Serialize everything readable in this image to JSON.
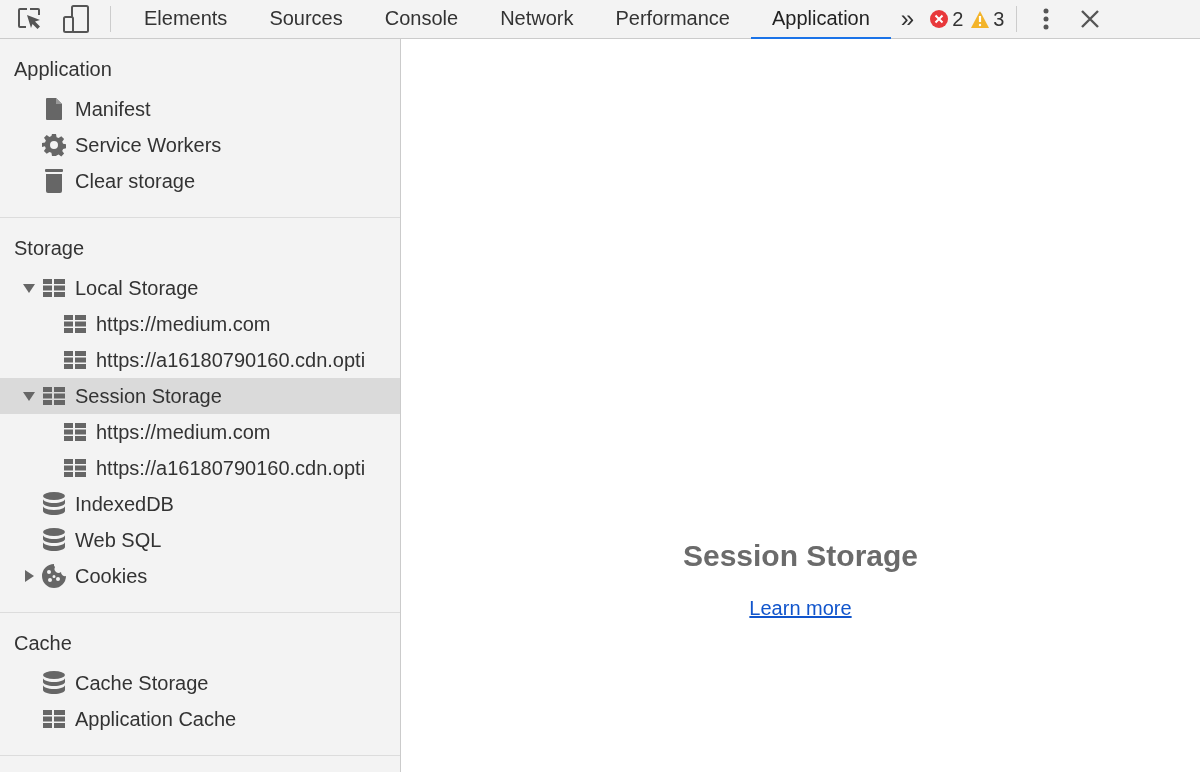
{
  "toolbar": {
    "tabs": [
      {
        "label": "Elements",
        "selected": false
      },
      {
        "label": "Sources",
        "selected": false
      },
      {
        "label": "Console",
        "selected": false
      },
      {
        "label": "Network",
        "selected": false
      },
      {
        "label": "Performance",
        "selected": false
      },
      {
        "label": "Application",
        "selected": true
      }
    ],
    "more": "»",
    "errors": "2",
    "warnings": "3"
  },
  "sidebar": {
    "sections": [
      {
        "title": "Application",
        "items": [
          {
            "label": "Manifest",
            "kind": "file",
            "selected": false
          },
          {
            "label": "Service Workers",
            "kind": "gear",
            "selected": false
          },
          {
            "label": "Clear storage",
            "kind": "trash",
            "selected": false
          }
        ]
      },
      {
        "title": "Storage",
        "items": [
          {
            "label": "Local Storage",
            "kind": "grid",
            "expanded": true,
            "selected": false,
            "children": [
              {
                "label": "https://medium.com",
                "kind": "grid",
                "selected": false
              },
              {
                "label": "https://a16180790160.cdn.opti",
                "kind": "grid",
                "selected": false
              }
            ]
          },
          {
            "label": "Session Storage",
            "kind": "grid",
            "expanded": true,
            "selected": true,
            "children": [
              {
                "label": "https://medium.com",
                "kind": "grid",
                "selected": false
              },
              {
                "label": "https://a16180790160.cdn.opti",
                "kind": "grid",
                "selected": false
              }
            ]
          },
          {
            "label": "IndexedDB",
            "kind": "db",
            "selected": false
          },
          {
            "label": "Web SQL",
            "kind": "db",
            "selected": false
          },
          {
            "label": "Cookies",
            "kind": "cookie",
            "expanded": false,
            "selected": false
          }
        ]
      },
      {
        "title": "Cache",
        "items": [
          {
            "label": "Cache Storage",
            "kind": "db",
            "selected": false
          },
          {
            "label": "Application Cache",
            "kind": "grid",
            "selected": false
          }
        ]
      }
    ]
  },
  "main": {
    "title": "Session Storage",
    "link": "Learn more"
  }
}
